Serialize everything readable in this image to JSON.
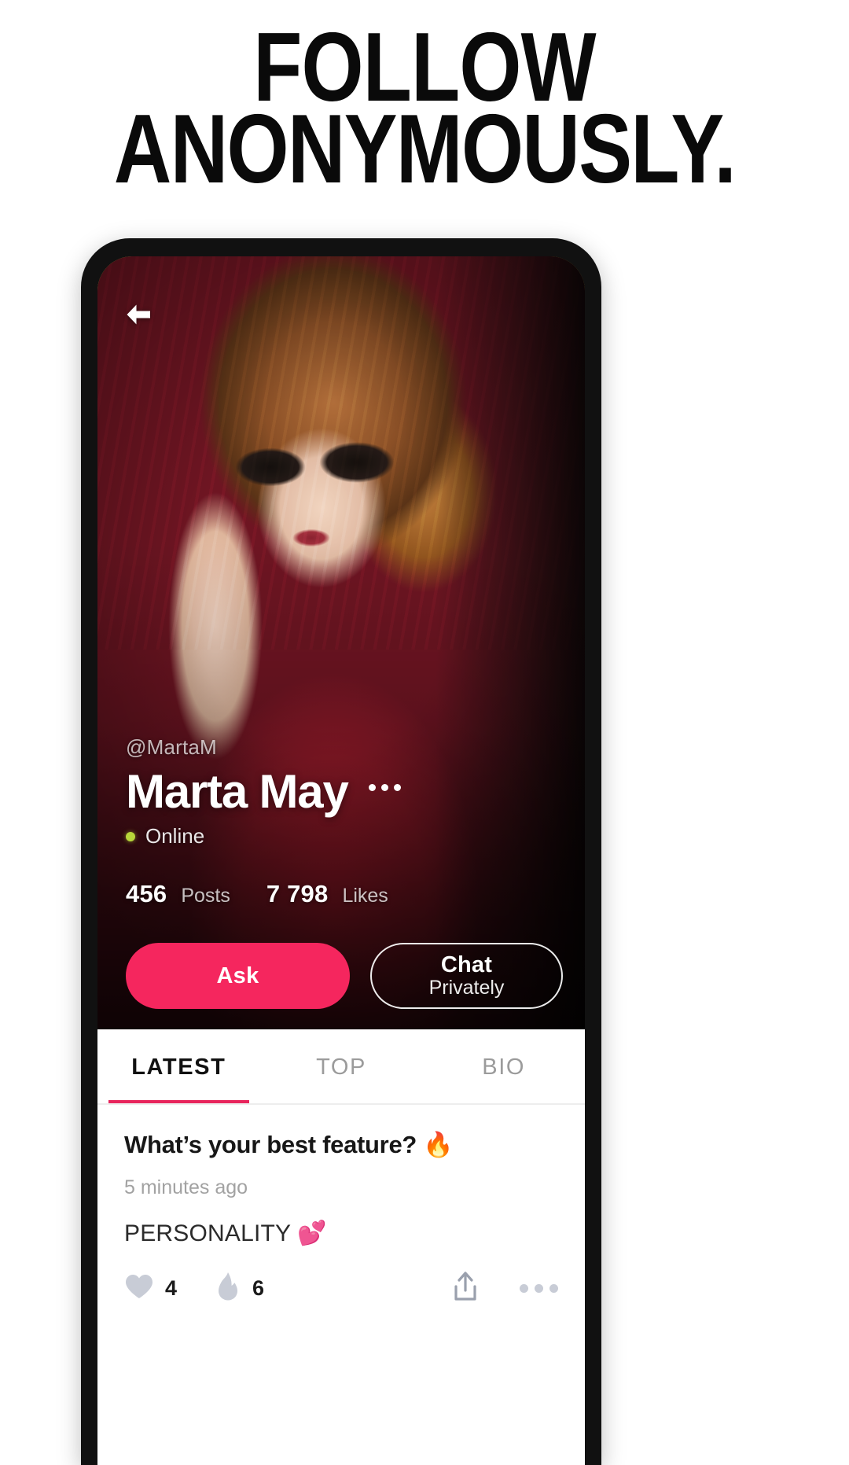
{
  "headline": {
    "line1": "FOLLOW",
    "line2": "ANONYMOUSLY."
  },
  "phone": {
    "back_icon": "arrow-left-icon",
    "profile": {
      "handle": "@MartaM",
      "display_name": "Marta May",
      "more_icon": "more-horizontal-icon",
      "status": "Online",
      "status_color": "#b7d63a",
      "stats": [
        {
          "value": "456",
          "label": "Posts"
        },
        {
          "value": "7 798",
          "label": "Likes"
        }
      ],
      "ask_button": "Ask",
      "chat_button_line1": "Chat",
      "chat_button_line2": "Privately",
      "accent_color": "#F5265E"
    },
    "tabs": [
      {
        "label": "LATEST",
        "active": true
      },
      {
        "label": "TOP",
        "active": false
      },
      {
        "label": "BIO",
        "active": false
      }
    ],
    "tab_indicator_color": "#E8245C",
    "post": {
      "title": "What’s your best feature? 🔥",
      "time": "5 minutes ago",
      "answer": "PERSONALITY 💕",
      "reactions": [
        {
          "icon": "heart-icon",
          "count": "4"
        },
        {
          "icon": "flame-icon",
          "count": "6"
        }
      ],
      "share_icon": "share-upload-icon",
      "more_icon": "more-horizontal-icon"
    }
  }
}
